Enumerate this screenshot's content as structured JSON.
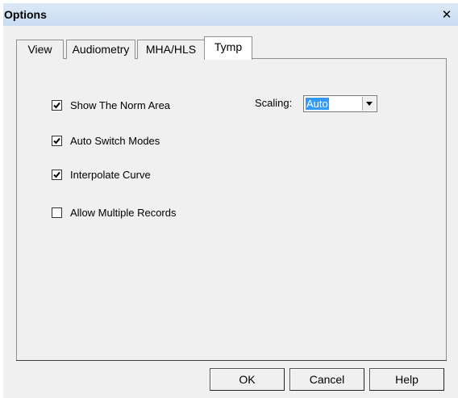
{
  "window": {
    "title": "Options",
    "close_glyph": "✕"
  },
  "tabs": [
    {
      "label": "View",
      "active": false
    },
    {
      "label": "Audiometry",
      "active": false
    },
    {
      "label": "MHA/HLS",
      "active": false
    },
    {
      "label": "Tymp",
      "active": true
    }
  ],
  "options": [
    {
      "label": "Show The Norm Area",
      "checked": true
    },
    {
      "label": "Auto Switch Modes",
      "checked": true
    },
    {
      "label": "Interpolate Curve",
      "checked": true
    },
    {
      "label": "Allow Multiple Records",
      "checked": false
    }
  ],
  "scaling": {
    "label": "Scaling:",
    "value": "Auto"
  },
  "buttons": {
    "ok": "OK",
    "cancel": "Cancel",
    "help": "Help"
  },
  "colors": {
    "selection": "#3399ff",
    "dialog_bg": "#f0f0f0",
    "title_bar": "#dce8f6"
  }
}
